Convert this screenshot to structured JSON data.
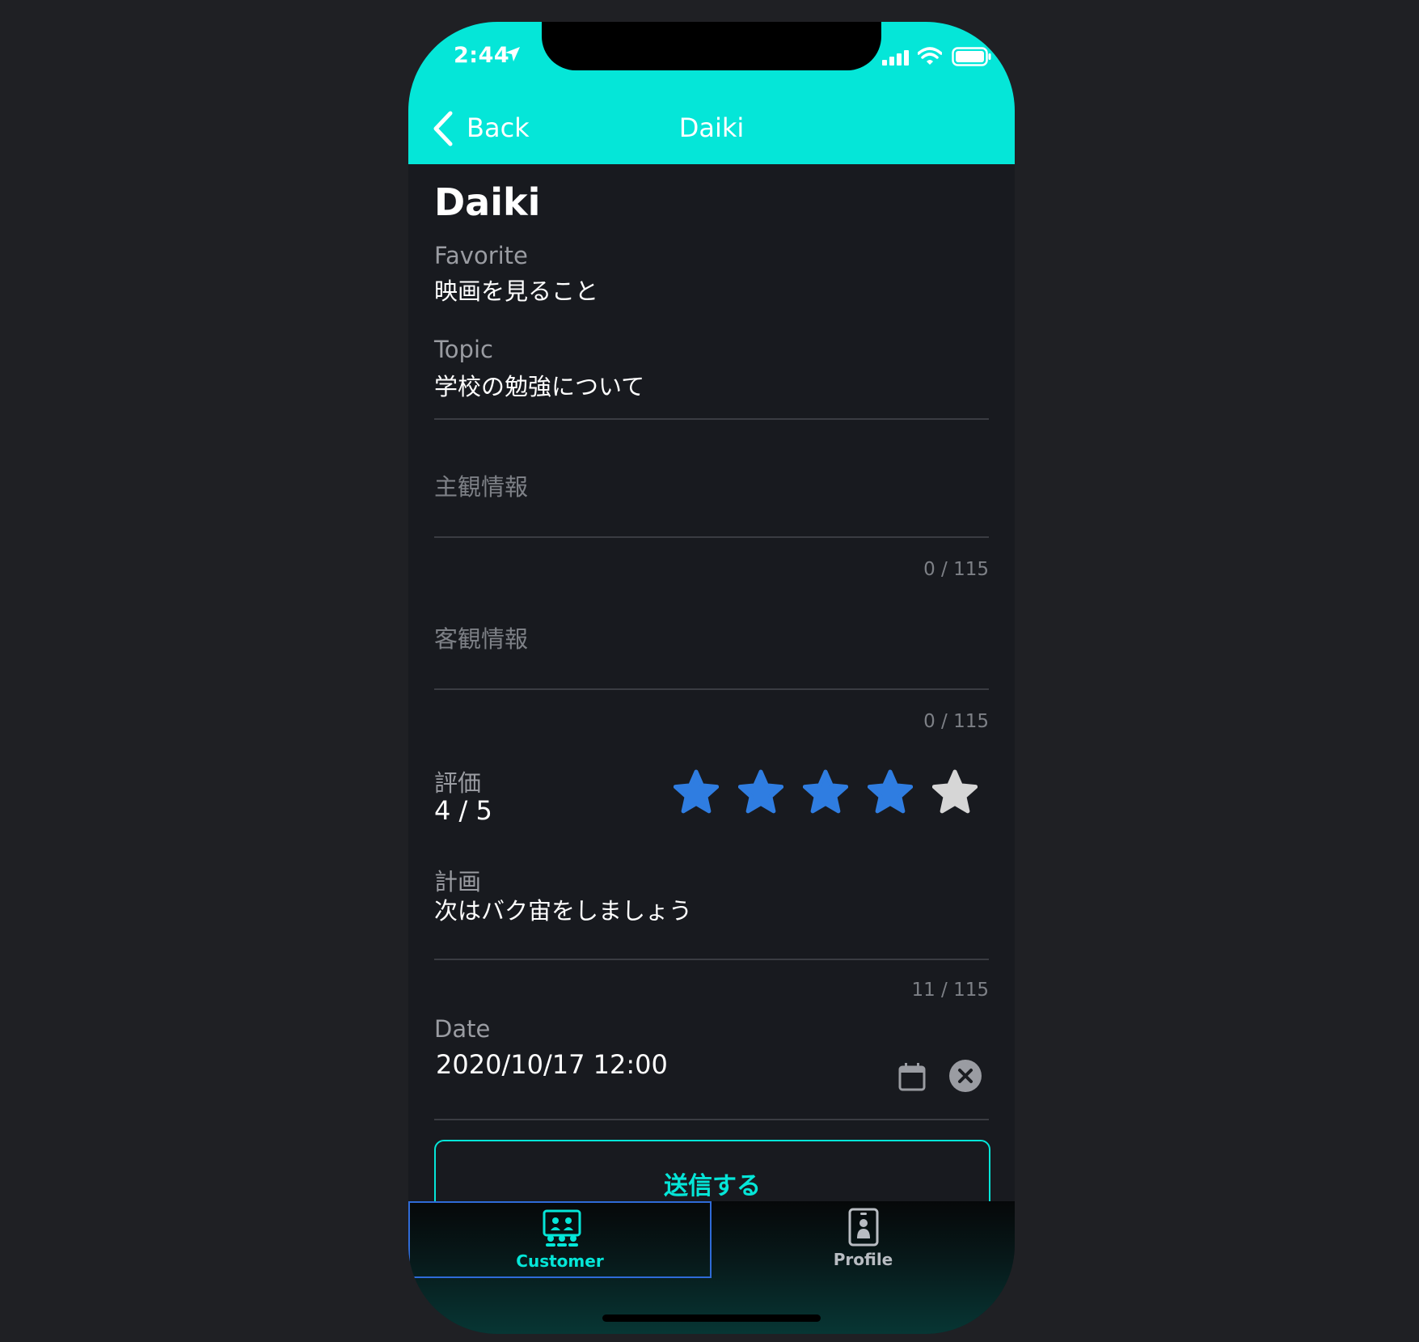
{
  "status_bar": {
    "time": "2:44"
  },
  "nav": {
    "back_label": "Back",
    "title": "Daiki"
  },
  "profile": {
    "name": "Daiki"
  },
  "favorite": {
    "label": "Favorite",
    "value": "映画を見ること"
  },
  "topic": {
    "label": "Topic",
    "value": "学校の勉強について"
  },
  "subjective": {
    "placeholder": "主観情報",
    "counter": "0 / 115"
  },
  "objective": {
    "placeholder": "客観情報",
    "counter": "0 / 115"
  },
  "rating": {
    "label": "評価",
    "value_text": "4 / 5",
    "value": 4,
    "max": 5
  },
  "plan": {
    "label": "計画",
    "value": "次はバク宙をしましょう",
    "counter": "11 / 115"
  },
  "date": {
    "label": "Date",
    "value": "2020/10/17 12:00"
  },
  "submit_label": "送信する",
  "tabs": [
    {
      "label": "Customer",
      "icon": "customer-group-icon",
      "active": true
    },
    {
      "label": "Profile",
      "icon": "profile-badge-icon",
      "active": false
    }
  ],
  "colors": {
    "accent": "#05e6d8",
    "star_filled": "#2f7de1",
    "star_empty": "#d6d6d6",
    "background": "#181a1f",
    "tab_active": "#05e6d8",
    "tab_inactive": "#b8bcc2"
  }
}
